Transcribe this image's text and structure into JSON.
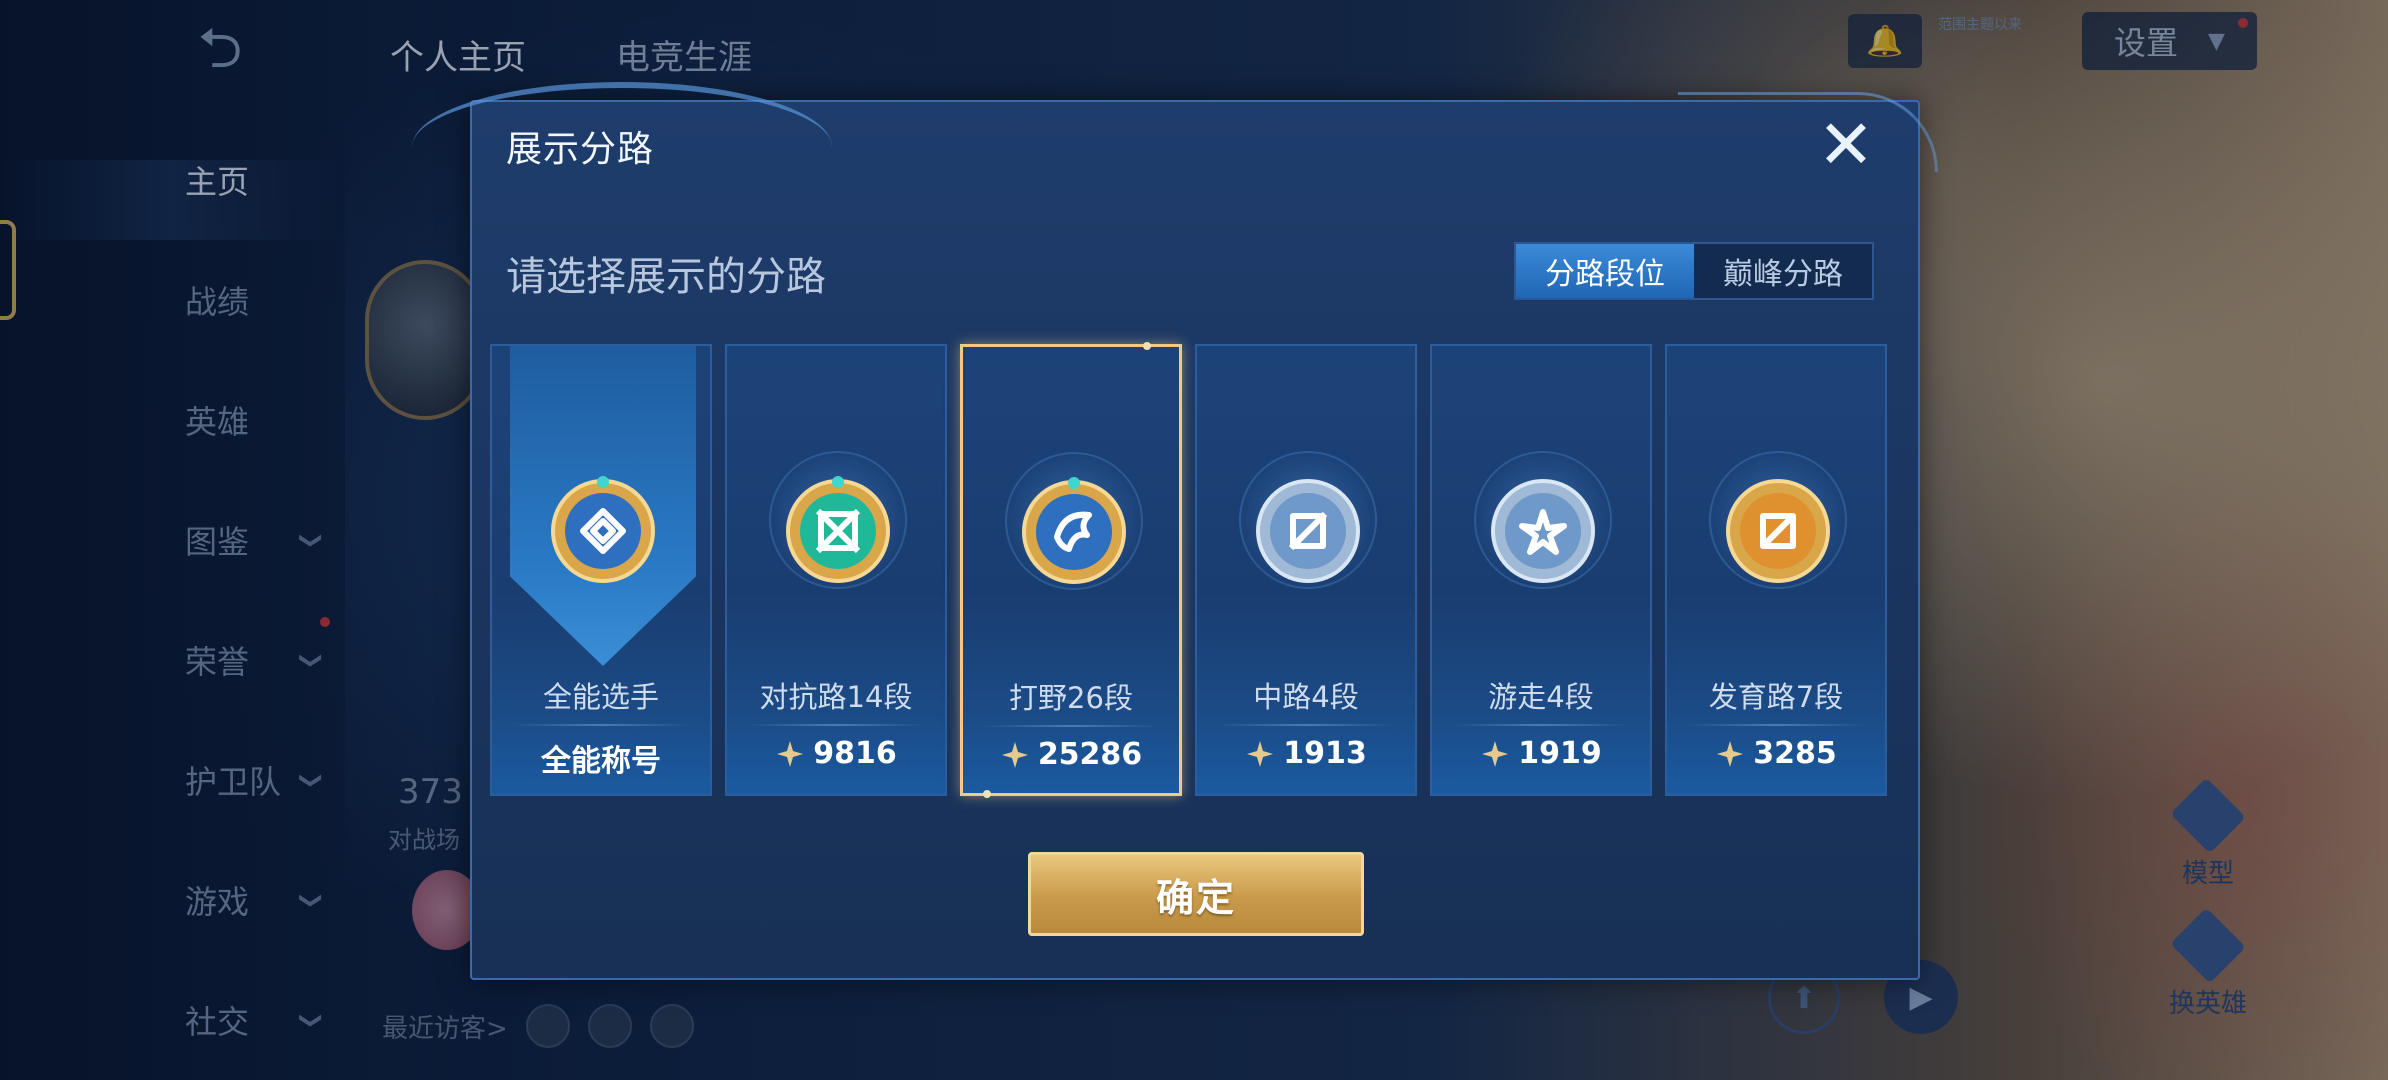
{
  "background": {
    "sidebar": {
      "items": [
        {
          "label": "主页",
          "active": true,
          "chevron": false
        },
        {
          "label": "战绩",
          "active": false,
          "chevron": false
        },
        {
          "label": "英雄",
          "active": false,
          "chevron": false
        },
        {
          "label": "图鉴",
          "active": false,
          "chevron": true
        },
        {
          "label": "荣誉",
          "active": false,
          "chevron": true
        },
        {
          "label": "护卫队",
          "active": false,
          "chevron": true
        },
        {
          "label": "游戏",
          "active": false,
          "chevron": true
        },
        {
          "label": "社交",
          "active": false,
          "chevron": true
        }
      ],
      "back_icon": "back-arrow-icon"
    },
    "top_tabs": [
      "个人主页",
      "电竞生涯"
    ],
    "stat_number": "373",
    "stat_label": "对战场",
    "recent_visitors_label": "最近访客>",
    "settings_label": "设置",
    "notice_text": "范围主题以来",
    "right_controls": [
      "模型",
      "换英雄"
    ]
  },
  "modal": {
    "title": "展示分路",
    "subtitle": "请选择展示的分路",
    "toggle": {
      "options": [
        "分路段位",
        "巅峰分路"
      ],
      "selected": "分路段位"
    },
    "cards": [
      {
        "name": "全能选手",
        "value": "全能称号",
        "emblem_color": "#2f6fc0",
        "has_gem": false,
        "selected": false,
        "ribbon": true
      },
      {
        "name": "对抗路14段",
        "value": "9816",
        "emblem_color": "#1fb99a",
        "has_gem": true,
        "selected": false,
        "ribbon": false
      },
      {
        "name": "打野26段",
        "value": "25286",
        "emblem_color": "#2f6fc0",
        "has_gem": true,
        "selected": true,
        "ribbon": false
      },
      {
        "name": "中路4段",
        "value": "1913",
        "emblem_color": "#6e99c8",
        "has_gem": true,
        "selected": false,
        "ribbon": false
      },
      {
        "name": "游走4段",
        "value": "1919",
        "emblem_color": "#6e99c8",
        "has_gem": true,
        "selected": false,
        "ribbon": false
      },
      {
        "name": "发育路7段",
        "value": "3285",
        "emblem_color": "#e0912f",
        "has_gem": true,
        "selected": false,
        "ribbon": false
      }
    ],
    "confirm_label": "确定"
  },
  "colors": {
    "accent_gold": "#f1c98a",
    "button_gold": "#c99a4a",
    "toggle_active": "#2a78c8"
  }
}
